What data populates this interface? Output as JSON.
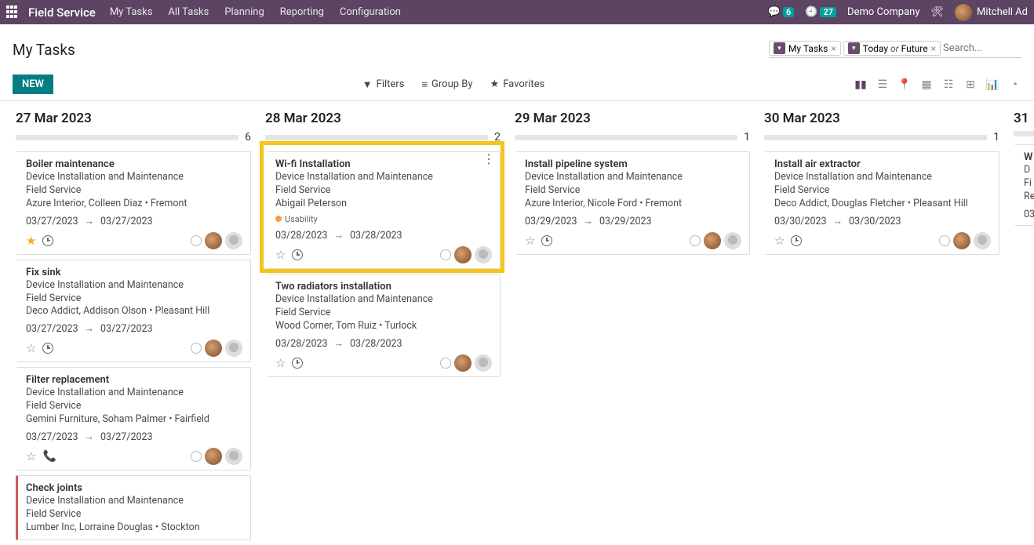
{
  "nav": {
    "brand": "Field Service",
    "menu": [
      "My Tasks",
      "All Tasks",
      "Planning",
      "Reporting",
      "Configuration"
    ],
    "msg_badge": "6",
    "clock_badge": "27",
    "company": "Demo Company",
    "user": "Mitchell Ad"
  },
  "header": {
    "title": "My Tasks",
    "chips": [
      {
        "label": "My Tasks"
      },
      {
        "label_html": "Today <em>or</em> Future"
      }
    ],
    "search_placeholder": "Search...",
    "new_btn": "NEW",
    "filters": "Filters",
    "groupby": "Group By",
    "favorites": "Favorites"
  },
  "columns": [
    {
      "date": "27 Mar 2023",
      "count": "6",
      "cards": [
        {
          "title": "Boiler maintenance",
          "l1": "Device Installation and Maintenance",
          "l2": "Field Service",
          "l3": "Azure Interior, Colleen Diaz • Fremont",
          "d1": "03/27/2023",
          "d2": "03/27/2023",
          "star": true,
          "phone": false
        },
        {
          "title": "Fix sink",
          "l1": "Device Installation and Maintenance",
          "l2": "Field Service",
          "l3": "Deco Addict, Addison Olson • Pleasant Hill",
          "d1": "03/27/2023",
          "d2": "03/27/2023",
          "star": false,
          "phone": false
        },
        {
          "title": "Filter replacement",
          "l1": "Device Installation and Maintenance",
          "l2": "Field Service",
          "l3": "Gemini Furniture, Soham Palmer • Fairfield",
          "d1": "03/27/2023",
          "d2": "03/27/2023",
          "star": false,
          "phone": true
        },
        {
          "title": "Check joints",
          "l1": "Device Installation and Maintenance",
          "l2": "Field Service",
          "l3": "Lumber Inc, Lorraine Douglas • Stockton",
          "d1": "",
          "d2": "",
          "red": true,
          "nofooter": true
        }
      ]
    },
    {
      "date": "28 Mar 2023",
      "count": "2",
      "cards": [
        {
          "title": "Wi-fi Installation",
          "l1": "Device Installation and Maintenance",
          "l2": "Field Service",
          "l3": "Abigail Peterson",
          "tag": "Usability",
          "d1": "03/28/2023",
          "d2": "03/28/2023",
          "star": false,
          "phone": false,
          "kebab": true,
          "highlighted": true
        },
        {
          "title": "Two radiators installation",
          "l1": "Device Installation and Maintenance",
          "l2": "Field Service",
          "l3": "Wood Corner, Tom Ruiz • Turlock",
          "d1": "03/28/2023",
          "d2": "03/28/2023",
          "star": false,
          "phone": false
        }
      ]
    },
    {
      "date": "29 Mar 2023",
      "count": "1",
      "cards": [
        {
          "title": "Install pipeline system",
          "l1": "Device Installation and Maintenance",
          "l2": "Field Service",
          "l3": "Azure Interior, Nicole Ford • Fremont",
          "d1": "03/29/2023",
          "d2": "03/29/2023",
          "star": false,
          "phone": false
        }
      ]
    },
    {
      "date": "30 Mar 2023",
      "count": "1",
      "cards": [
        {
          "title": "Install air extractor",
          "l1": "Device Installation and Maintenance",
          "l2": "Field Service",
          "l3": "Deco Addict, Douglas Fletcher • Pleasant Hill",
          "d1": "03/30/2023",
          "d2": "03/30/2023",
          "star": false,
          "phone": false
        }
      ]
    },
    {
      "date": "31",
      "count": "",
      "partial": true,
      "cards": [
        {
          "title": "W",
          "l1": "D",
          "l2": "Fi",
          "l3": "Re",
          "d1": "03",
          "d2": "",
          "nofooter": true
        }
      ]
    }
  ]
}
